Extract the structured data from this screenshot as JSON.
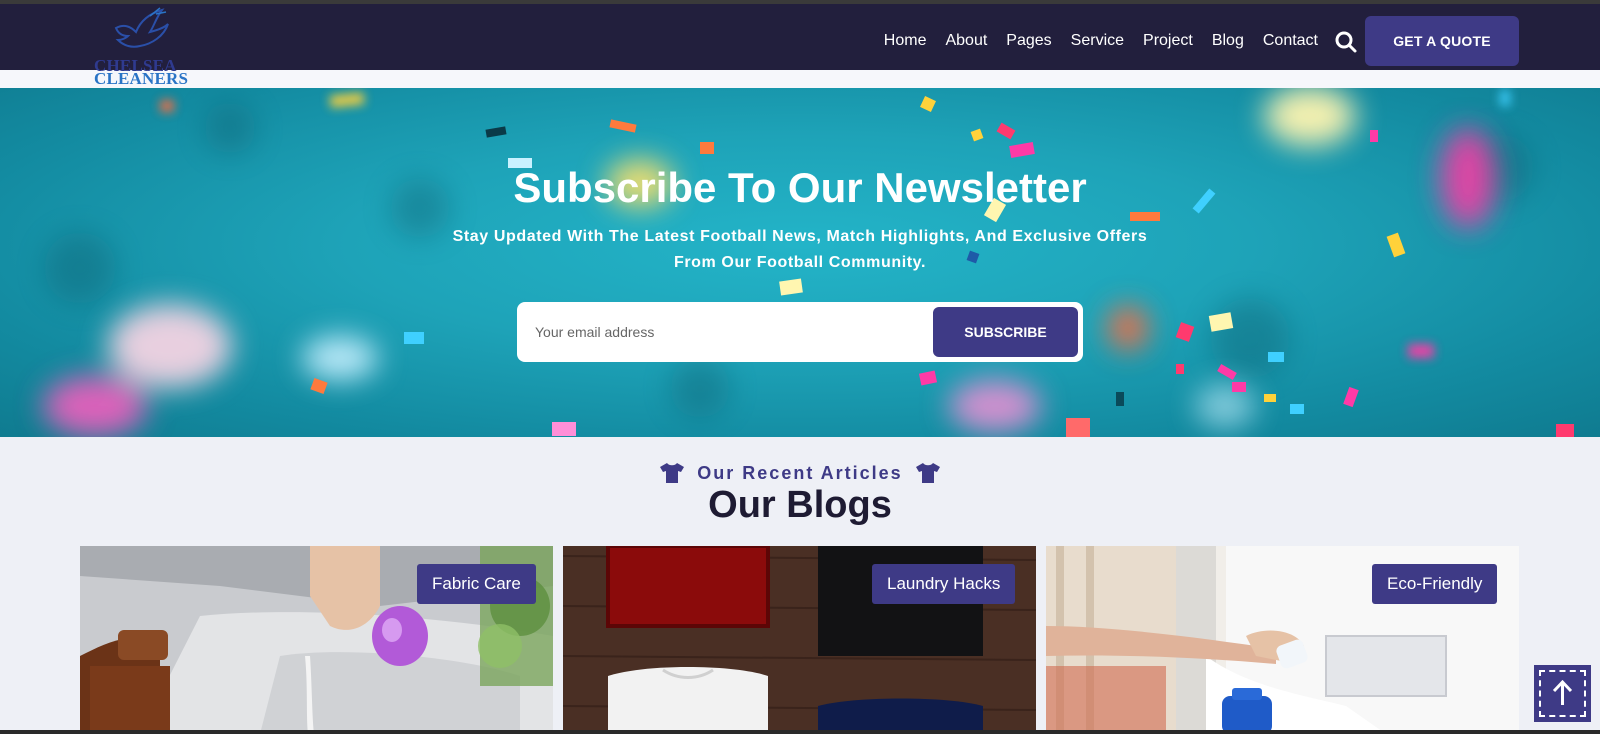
{
  "brand": {
    "line1": "CHELSEA",
    "line2": "CLEANERS"
  },
  "nav": {
    "items": [
      {
        "label": "Home"
      },
      {
        "label": "About"
      },
      {
        "label": "Pages"
      },
      {
        "label": "Service"
      },
      {
        "label": "Project"
      },
      {
        "label": "Blog"
      },
      {
        "label": "Contact"
      }
    ],
    "search_icon": "search-icon",
    "cta_label": "GET A QUOTE"
  },
  "newsletter": {
    "title": "Subscribe To Our Newsletter",
    "subtitle": "Stay Updated With The Latest Football News, Match Highlights, And Exclusive Offers From Our Football Community.",
    "email_placeholder": "Your email address",
    "button_label": "SUBSCRIBE"
  },
  "blogs": {
    "eyebrow": "Our Recent Articles",
    "eyebrow_icon": "tshirt-icon",
    "title": "Our Blogs",
    "cards": [
      {
        "tag": "Fabric Care"
      },
      {
        "tag": "Laundry Hacks"
      },
      {
        "tag": "Eco-Friendly"
      }
    ]
  },
  "back_to_top_icon": "arrow-up-icon",
  "colors": {
    "nav_bg": "#221f3d",
    "accent": "#3e3a86",
    "hero_bg": "#1ea3b8",
    "page_bg": "#eef0f6"
  }
}
